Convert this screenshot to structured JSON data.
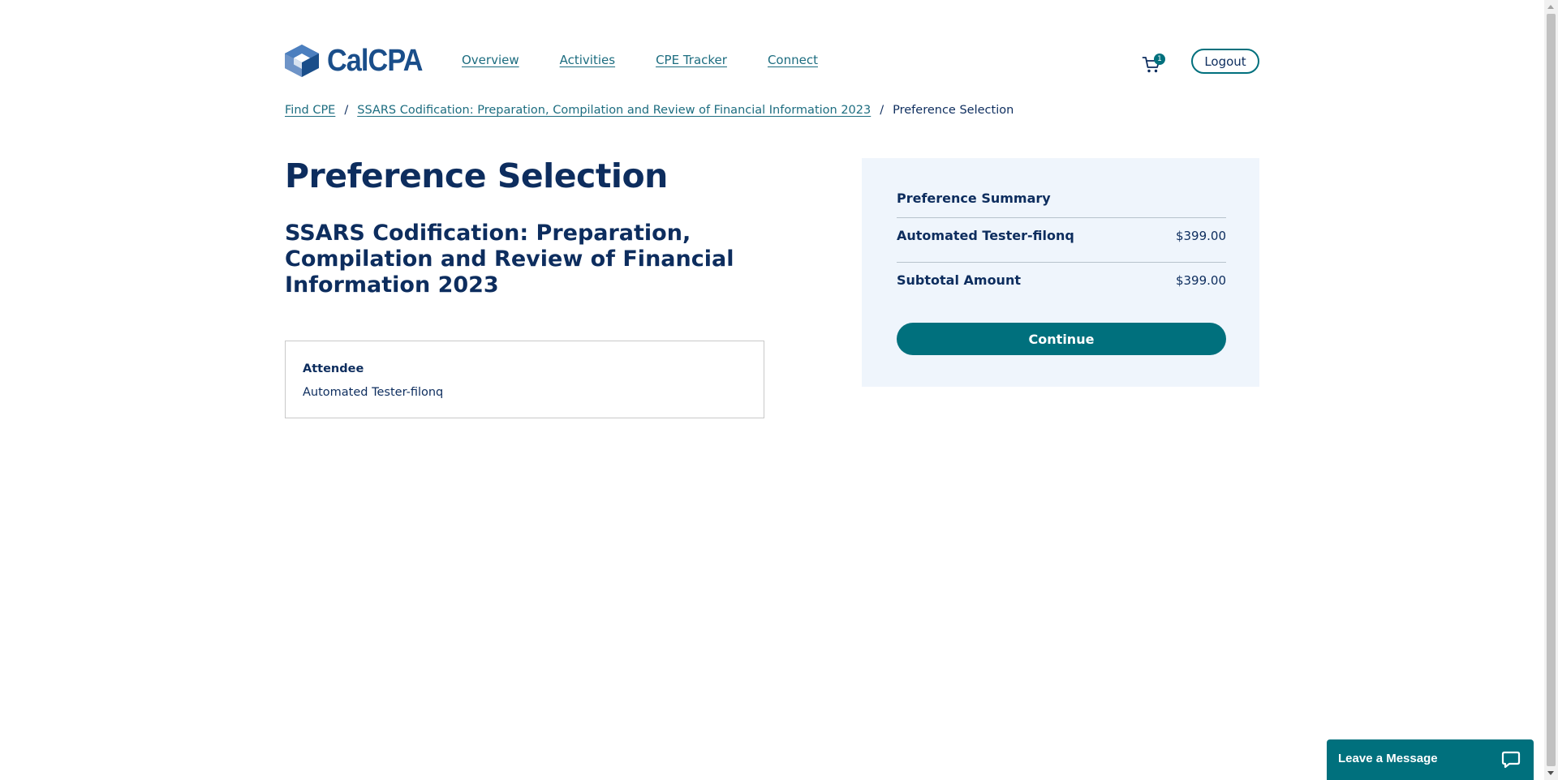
{
  "header": {
    "logo_text": "CalCPA",
    "nav": [
      {
        "label": "Overview"
      },
      {
        "label": "Activities"
      },
      {
        "label": "CPE Tracker"
      },
      {
        "label": "Connect"
      }
    ],
    "cart_count": "1",
    "logout_label": "Logout"
  },
  "breadcrumb": {
    "items": [
      {
        "label": "Find CPE"
      },
      {
        "label": "SSARS Codification: Preparation, Compilation and Review of Financial Information 2023"
      }
    ],
    "separator": "/",
    "current": "Preference Selection"
  },
  "main": {
    "title": "Preference Selection",
    "course_title": "SSARS Codification: Preparation, Compilation and Review of Financial Information 2023",
    "attendee": {
      "label": "Attendee",
      "name": "Automated Tester-filonq"
    }
  },
  "summary": {
    "title": "Preference Summary",
    "line_item": {
      "name": "Automated Tester-filonq",
      "price": "$399.00"
    },
    "subtotal": {
      "label": "Subtotal Amount",
      "price": "$399.00"
    },
    "continue_label": "Continue"
  },
  "chat": {
    "label": "Leave a Message"
  },
  "colors": {
    "brand_navy": "#0d2d5e",
    "accent_teal": "#00707d",
    "link_teal": "#1d6d80",
    "summary_bg": "#eff5fc"
  },
  "icons": {
    "logo": "calcpa-cube-logo",
    "cart": "shopping-cart-icon",
    "chat": "chat-bubble-icon"
  }
}
